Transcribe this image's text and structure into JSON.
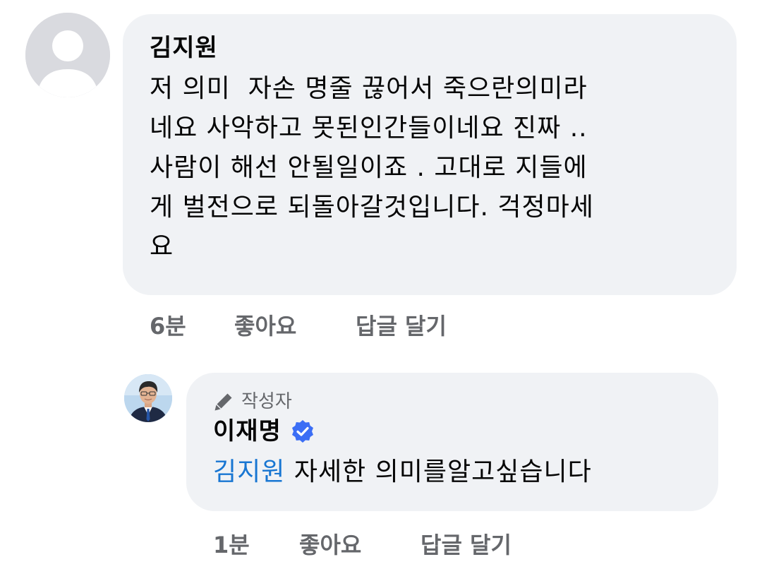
{
  "comment": {
    "author": "김지원",
    "text": "저 의미  자손 명줄 끊어서 죽으란의미라\n네요 사악하고 못된인간들이네요 진짜 ..\n사람이 해선 안될일이죠 . 고대로 지들에\n게 벌전으로 되돌아갈것입니다. 걱정마세\n요",
    "time": "6분",
    "like_label": "좋아요",
    "reply_label": "답글 달기",
    "avatar_icon": "default-profile-icon"
  },
  "reply": {
    "badge_icon": "pencil-icon",
    "badge_label": "작성자",
    "author": "이재명",
    "verified_icon": "verified-badge-icon",
    "mention": "김지원",
    "text": " 자세한 의미를알고싶습니다",
    "time": "1분",
    "like_label": "좋아요",
    "reply_label": "답글 달기",
    "avatar_icon": "author-profile-photo"
  },
  "colors": {
    "bubble": "#f0f2f5",
    "secondary_text": "#65676b",
    "mention": "#1876d2",
    "verified": "#3b6ef5"
  }
}
